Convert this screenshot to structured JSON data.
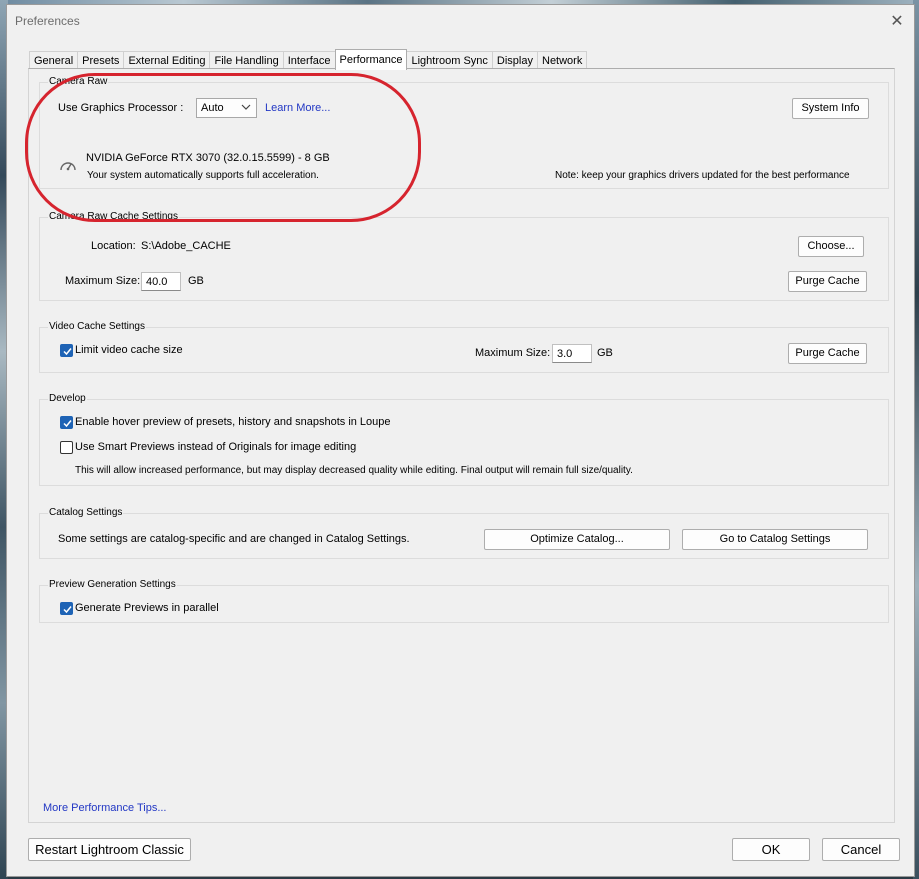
{
  "window": {
    "title": "Preferences"
  },
  "tabs": [
    {
      "label": "General"
    },
    {
      "label": "Presets"
    },
    {
      "label": "External Editing"
    },
    {
      "label": "File Handling"
    },
    {
      "label": "Interface"
    },
    {
      "label": "Performance"
    },
    {
      "label": "Lightroom Sync"
    },
    {
      "label": "Display"
    },
    {
      "label": "Network"
    }
  ],
  "active_tab": "Performance",
  "camera_raw": {
    "title": "Camera Raw",
    "gpu_label": "Use Graphics Processor :",
    "gpu_value": "Auto",
    "learn_more": "Learn More...",
    "system_info": "System Info",
    "gpu_name": "NVIDIA GeForce RTX 3070 (32.0.15.5599) - 8 GB",
    "gpu_status": "Your system automatically supports full acceleration.",
    "note": "Note: keep your graphics drivers updated for the best performance",
    "icon": "speedometer-icon"
  },
  "cache": {
    "title": "Camera Raw Cache Settings",
    "location_label": "Location:",
    "location_value": "S:\\Adobe_CACHE",
    "choose": "Choose...",
    "max_label": "Maximum Size:",
    "max_value": "40.0",
    "unit": "GB",
    "purge": "Purge Cache"
  },
  "video_cache": {
    "title": "Video Cache Settings",
    "limit_label": "Limit video cache size",
    "limit_checked": true,
    "max_label": "Maximum Size:",
    "max_value": "3.0",
    "unit": "GB",
    "purge": "Purge Cache"
  },
  "develop": {
    "title": "Develop",
    "hover_label": "Enable hover preview of presets, history and snapshots in Loupe",
    "hover_checked": true,
    "smart_label": "Use Smart Previews instead of Originals for image editing",
    "smart_checked": false,
    "note": "This will allow increased performance, but may display decreased quality while editing. Final output will remain full size/quality."
  },
  "catalog": {
    "title": "Catalog Settings",
    "text": "Some settings are catalog-specific and are changed in Catalog Settings.",
    "optimize": "Optimize Catalog...",
    "goto": "Go to Catalog Settings"
  },
  "preview": {
    "title": "Preview Generation Settings",
    "parallel_label": "Generate Previews in parallel",
    "parallel_checked": true
  },
  "footer": {
    "tips": "More Performance Tips...",
    "restart": "Restart Lightroom Classic",
    "ok": "OK",
    "cancel": "Cancel"
  },
  "colors": {
    "accent": "#1e63b5",
    "link": "#2237c4",
    "annotation": "#d6242e"
  }
}
